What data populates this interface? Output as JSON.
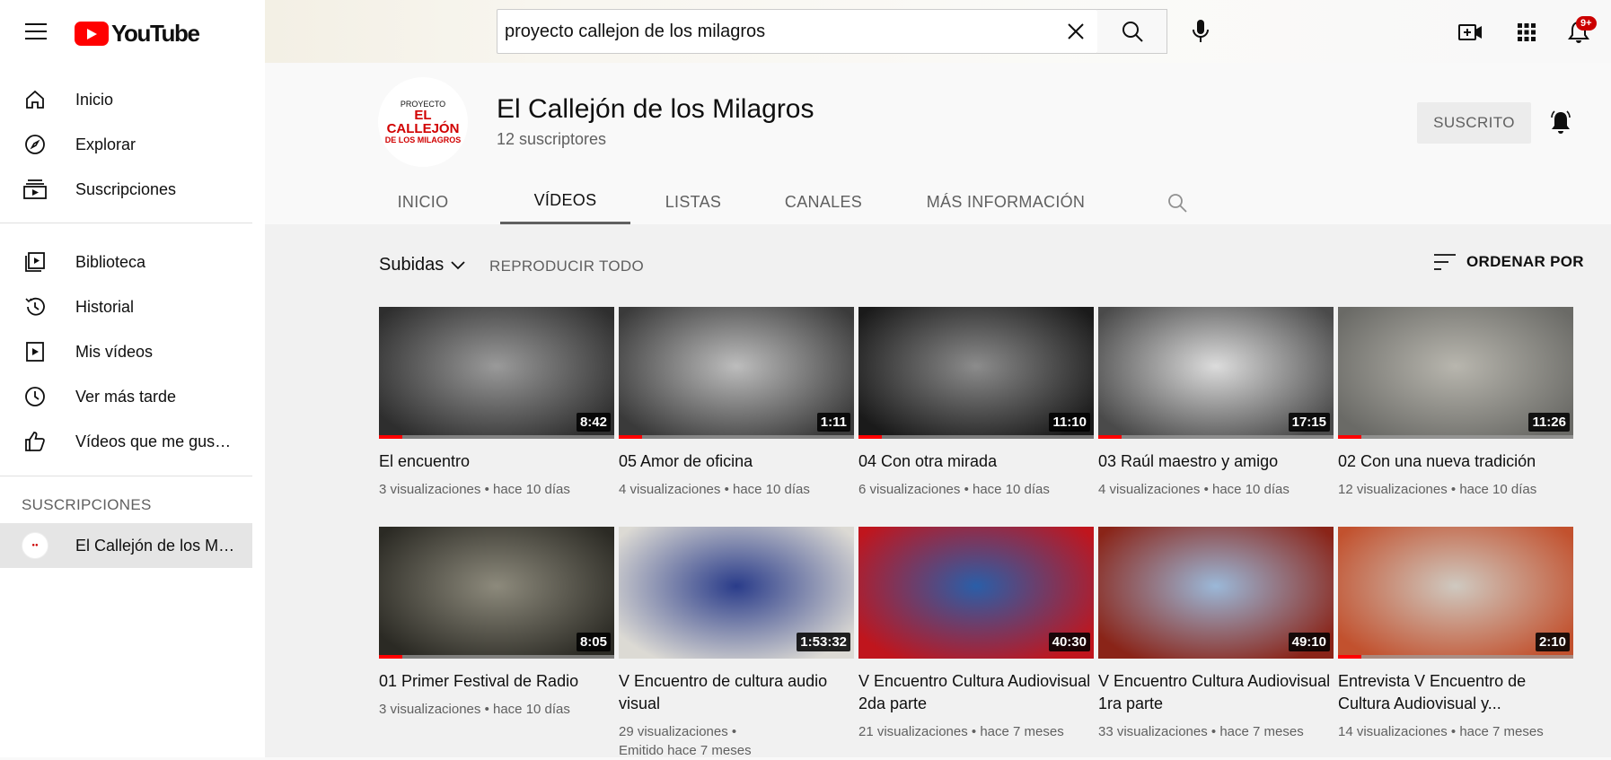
{
  "header": {
    "logo_text": "YouTube",
    "search_value": "proyecto callejon de los milagros",
    "notification_count": "9+",
    "icons": [
      "menu-icon",
      "youtube-logo",
      "close-icon",
      "search-icon",
      "mic-icon",
      "create-video-icon",
      "apps-icon",
      "bell-icon"
    ]
  },
  "sidebar": {
    "items": [
      {
        "label": "Inicio",
        "icon": "home-icon"
      },
      {
        "label": "Explorar",
        "icon": "compass-icon"
      },
      {
        "label": "Suscripciones",
        "icon": "subscriptions-icon"
      },
      {
        "label": "Biblioteca",
        "icon": "library-icon"
      },
      {
        "label": "Historial",
        "icon": "history-icon"
      },
      {
        "label": "Mis vídeos",
        "icon": "my-videos-icon"
      },
      {
        "label": "Ver más tarde",
        "icon": "clock-icon"
      },
      {
        "label": "Vídeos que me gustan",
        "icon": "thumbs-up-icon"
      }
    ],
    "subscriptions_heading": "SUSCRIPCIONES",
    "subscriptions": [
      {
        "label": "El Callejón de los Milagros"
      }
    ]
  },
  "channel": {
    "avatar_line1": "PROYECTO",
    "avatar_line2": "EL CALLEJÓN",
    "avatar_line3": "DE LOS MILAGROS",
    "name": "El Callejón de los Milagros",
    "subscribers": "12 suscriptores",
    "subscribe_label": "SUSCRITO",
    "tabs": [
      "INICIO",
      "VÍDEOS",
      "LISTAS",
      "CANALES",
      "MÁS INFORMACIÓN"
    ],
    "active_tab": "VÍDEOS"
  },
  "toolbar": {
    "filter_label": "Subidas",
    "play_all_label": "REPRODUCIR TODO",
    "sort_label": "ORDENAR POR"
  },
  "videos": [
    {
      "title": "El encuentro",
      "views": "3 visualizaciones",
      "age": "hace 10 días",
      "duration": "8:42",
      "progress": 0.1,
      "thumb_colors": [
        "#2e2e2e",
        "#9a9a9a"
      ]
    },
    {
      "title": "05 Amor de oficina",
      "views": "4 visualizaciones",
      "age": "hace 10 días",
      "duration": "1:11",
      "progress": 0.1,
      "thumb_colors": [
        "#3a3a3a",
        "#bdbdbd"
      ]
    },
    {
      "title": "04 Con otra mirada",
      "views": "6 visualizaciones",
      "age": "hace 10 días",
      "duration": "11:10",
      "progress": 0.1,
      "thumb_colors": [
        "#1a1a1a",
        "#8c8c8c"
      ]
    },
    {
      "title": "03 Raúl maestro y amigo",
      "views": "4 visualizaciones",
      "age": "hace 10 días",
      "duration": "17:15",
      "progress": 0.1,
      "thumb_colors": [
        "#4a4a4a",
        "#dcdcdc"
      ]
    },
    {
      "title": "02 Con una nueva tradición",
      "views": "12 visualizaciones",
      "age": "hace 10 días",
      "duration": "11:26",
      "progress": 0.1,
      "thumb_colors": [
        "#6a6a66",
        "#b8b6ae"
      ]
    },
    {
      "title": "01 Primer Festival de Radio",
      "views": "3 visualizaciones",
      "age": "hace 10 días",
      "duration": "8:05",
      "progress": 0.1,
      "thumb_colors": [
        "#2b2a24",
        "#8d8a7c"
      ]
    },
    {
      "title": "V Encuentro de cultura audio visual",
      "views": "29 visualizaciones",
      "age": "Emitido hace 7 meses",
      "duration": "1:53:32",
      "progress": 0,
      "thumb_colors": [
        "#dcdad4",
        "#2a3c8a"
      ]
    },
    {
      "title": "V Encuentro Cultura Audiovisual 2da parte",
      "views": "21 visualizaciones",
      "age": "hace 7 meses",
      "duration": "40:30",
      "progress": 0,
      "thumb_colors": [
        "#c0151d",
        "#2a5ea8"
      ]
    },
    {
      "title": "V Encuentro Cultura Audiovisual 1ra parte",
      "views": "33 visualizaciones",
      "age": "hace 7 meses",
      "duration": "49:10",
      "progress": 0,
      "thumb_colors": [
        "#8a2418",
        "#9bb8d8"
      ]
    },
    {
      "title": "Entrevista V Encuentro de Cultura Audiovisual y...",
      "views": "14 visualizaciones",
      "age": "hace 7 meses",
      "duration": "2:10",
      "progress": 0.1,
      "thumb_colors": [
        "#c2512e",
        "#cfc9c0"
      ]
    }
  ],
  "colors": {
    "accent": "#ff0000",
    "badge": "#cc0000"
  }
}
